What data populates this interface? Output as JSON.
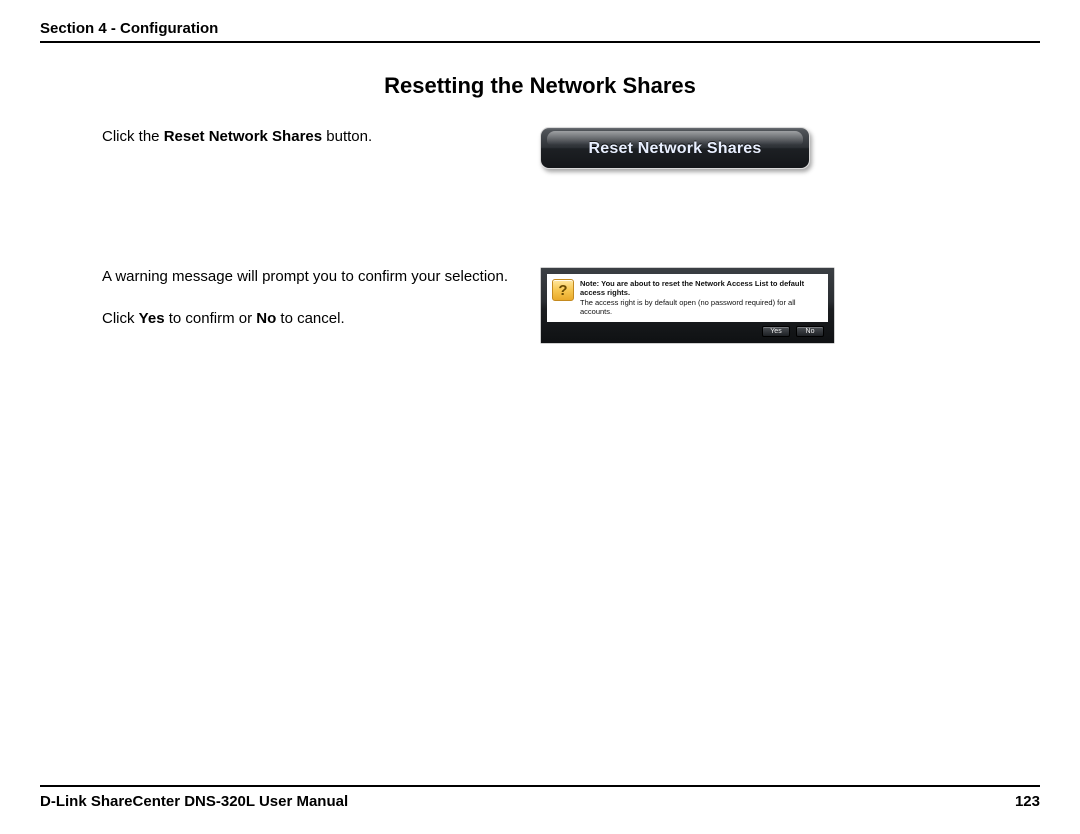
{
  "header": {
    "section_label": "Section 4 - Configuration"
  },
  "title": "Resetting the Network Shares",
  "step1": {
    "pre": "Click the ",
    "bold": "Reset Network Shares",
    "post": " button."
  },
  "step2": {
    "line1": "A warning message will prompt you to confirm your selection.",
    "line2_pre": "Click ",
    "line2_b1": "Yes",
    "line2_mid": " to confirm or ",
    "line2_b2": "No",
    "line2_post": " to cancel."
  },
  "button": {
    "label": "Reset Network Shares"
  },
  "dialog": {
    "icon_glyph": "?",
    "note_label": "Note:",
    "line1_rest": " You are about to reset the Network Access List to default access rights.",
    "line2": "The access right is by default open (no password required) for all accounts.",
    "yes": "Yes",
    "no": "No"
  },
  "footer": {
    "manual": "D-Link ShareCenter DNS-320L User Manual",
    "page": "123"
  }
}
